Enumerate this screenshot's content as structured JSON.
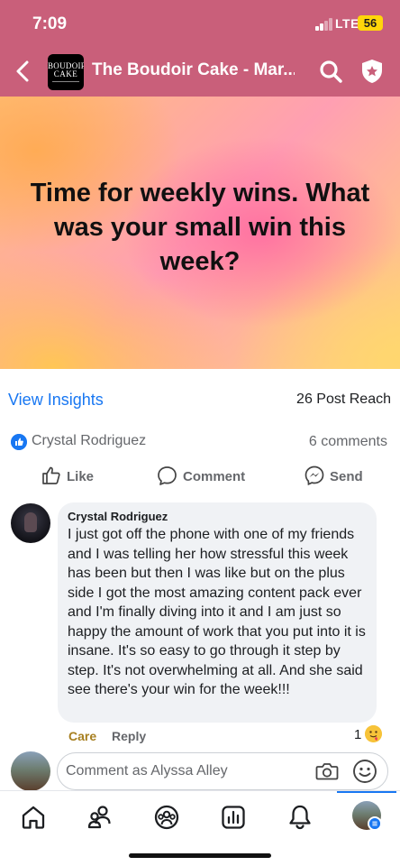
{
  "status": {
    "time": "7:09",
    "network": "LTE",
    "battery": "56"
  },
  "header": {
    "group_title": "The Boudoir Cake - Mar...",
    "avatar_line1": "BOUDOIR",
    "avatar_line2": "CAKE"
  },
  "post": {
    "image_text": "Time for weekly wins. What was your small win this week?",
    "insights_label": "View Insights",
    "reach": "26 Post Reach",
    "reactor_name": "Crystal Rodriguez",
    "comments_count": "6 comments",
    "actions": {
      "like": "Like",
      "comment": "Comment",
      "send": "Send"
    }
  },
  "comment": {
    "author": "Crystal Rodriguez",
    "text": "I just got off the phone with one of my friends and I was telling her how stressful this week has been but then I was like but on the plus side I got the most amazing content pack ever and I'm finally diving into it and I am just so happy the amount of work that you put into it is insane. It's so easy to go through it step by step. It's not overwhelming at all. And she said see there's your win for the week!!!",
    "reaction_label": "Care",
    "reply_label": "Reply",
    "reaction_count": "1"
  },
  "composer": {
    "placeholder": "Comment as Alyssa Alley"
  },
  "tabs": [
    "home-icon",
    "friends-icon",
    "groups-icon",
    "insights-icon",
    "notifications-icon",
    "profile-icon"
  ],
  "colors": {
    "header_bg": "#c95f7a",
    "accent": "#1877f2",
    "care": "#a77f20",
    "battery": "#ffd60a"
  }
}
